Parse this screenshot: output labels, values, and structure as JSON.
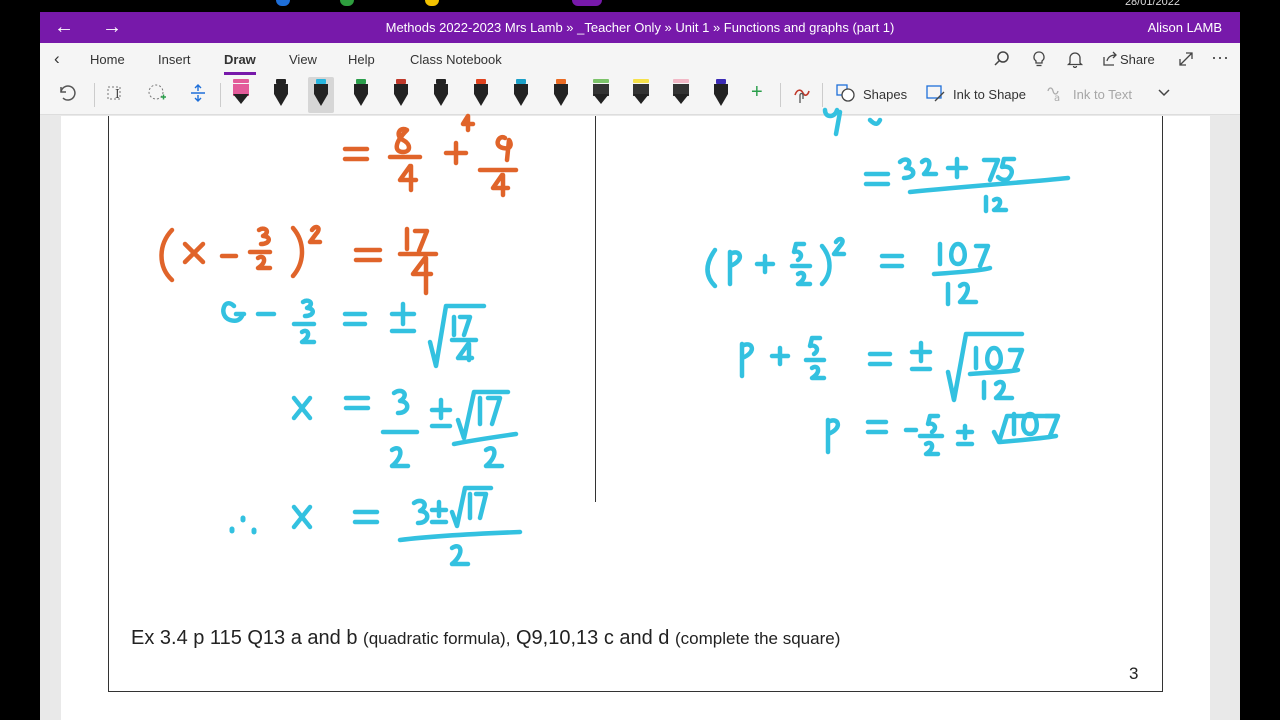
{
  "os": {
    "date": "28/01/2022",
    "dot_colors": [
      "#1e6fd9",
      "#2e9e3e",
      "#f2c200",
      "#7719aa"
    ]
  },
  "titlebar": {
    "back_icon": "←",
    "forward_icon": "→",
    "title": "Methods 2022-2023 Mrs Lamb » _Teacher Only » Unit 1 » Functions and graphs (part 1)",
    "user": "Alison LAMB",
    "accent": "#7719aa"
  },
  "tabs": {
    "back_icon": "‹",
    "items": [
      {
        "label": "Home"
      },
      {
        "label": "Insert"
      },
      {
        "label": "Draw"
      },
      {
        "label": "View"
      },
      {
        "label": "Help"
      },
      {
        "label": "Class Notebook"
      }
    ],
    "active": "Draw",
    "share_label": "Share",
    "icons": [
      "search-icon",
      "lightbulb-icon",
      "bell-icon",
      "share-icon",
      "expand-icon",
      "more-icon"
    ]
  },
  "toolbar": {
    "shapes_label": "Shapes",
    "ink_to_shape_label": "Ink to Shape",
    "ink_to_text_label": "Ink to Text",
    "pen_colors": [
      "#e35b9a",
      "#222222",
      "#27b5de",
      "#2a9e4b",
      "#c0392b",
      "#222222",
      "#e0421e",
      "#1aa0c8",
      "#ea6a22",
      "#7cc36a",
      "#f6e14a",
      "#f2b8c6",
      "#3b2bb5"
    ]
  },
  "ink": {
    "orange": "#e0642a",
    "cyan": "#33c1e0"
  },
  "note": {
    "exercise_main_1": "Ex 3.4 p 115 Q13 a and b",
    "exercise_small_1": "(quadratic formula),",
    "exercise_main_2": "Q9,10,13 c and d",
    "exercise_small_2": "(complete the square)",
    "page_number": "3"
  }
}
